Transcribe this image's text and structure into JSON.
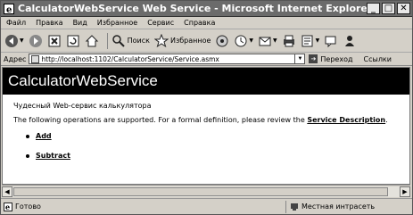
{
  "window": {
    "title": "CalculatorWebService Web Service - Microsoft Internet Explorer",
    "minimize": "_",
    "maximize": "□",
    "close": "✕"
  },
  "menu": [
    "Файл",
    "Правка",
    "Вид",
    "Избранное",
    "Сервис",
    "Справка"
  ],
  "toolbar": {
    "search_label": "Поиск",
    "favorites_label": "Избранное"
  },
  "address": {
    "label": "Адрес",
    "url": "http://localhost:1102/CalculatorService/Service.asmx",
    "go_label": "Переход",
    "links_label": "Ссылки"
  },
  "page": {
    "heading": "CalculatorWebService",
    "description": "Чудесный Web-сервис калькулятора",
    "intro": "The following operations are supported. For a formal definition, please review the",
    "service_description_link": "Service Description",
    "intro_end": ".",
    "operations": [
      "Add",
      "Subtract"
    ]
  },
  "status": {
    "left": "Готово",
    "zone": "Местная интрасеть"
  }
}
